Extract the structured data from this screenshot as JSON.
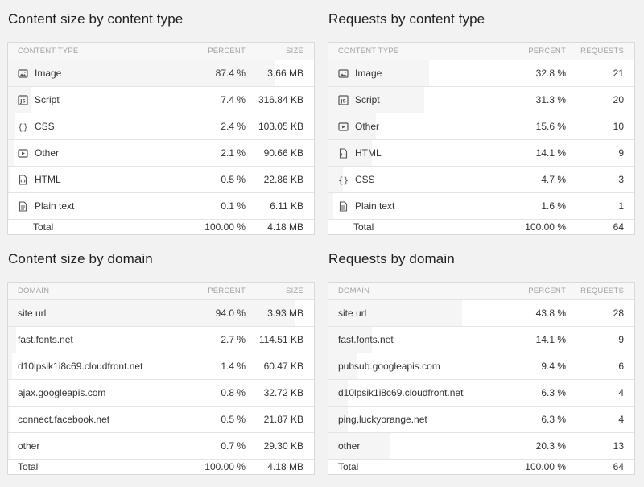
{
  "panels": {
    "size_type": {
      "title": "Content size by content type",
      "headers": {
        "name": "CONTENT TYPE",
        "pct": "PERCENT",
        "val": "SIZE"
      },
      "rows": [
        {
          "name": "Image",
          "pct": "87.4 %",
          "val": "3.66 MB",
          "share": 0.874,
          "icon": "image-icon"
        },
        {
          "name": "Script",
          "pct": "7.4 %",
          "val": "316.84 KB",
          "share": 0.074,
          "icon": "script-icon"
        },
        {
          "name": "CSS",
          "pct": "2.4 %",
          "val": "103.05 KB",
          "share": 0.024,
          "icon": "css-icon"
        },
        {
          "name": "Other",
          "pct": "2.1 %",
          "val": "90.66 KB",
          "share": 0.021,
          "icon": "other-icon"
        },
        {
          "name": "HTML",
          "pct": "0.5 %",
          "val": "22.86 KB",
          "share": 0.005,
          "icon": "html-icon"
        },
        {
          "name": "Plain text",
          "pct": "0.1 %",
          "val": "6.11 KB",
          "share": 0.001,
          "icon": "text-icon"
        }
      ],
      "total": {
        "name": "Total",
        "pct": "100.00 %",
        "val": "4.18 MB"
      }
    },
    "req_type": {
      "title": "Requests by content type",
      "headers": {
        "name": "CONTENT TYPE",
        "pct": "PERCENT",
        "val": "REQUESTS"
      },
      "rows": [
        {
          "name": "Image",
          "pct": "32.8 %",
          "val": "21",
          "share": 0.328,
          "icon": "image-icon"
        },
        {
          "name": "Script",
          "pct": "31.3 %",
          "val": "20",
          "share": 0.313,
          "icon": "script-icon"
        },
        {
          "name": "Other",
          "pct": "15.6 %",
          "val": "10",
          "share": 0.156,
          "icon": "other-icon"
        },
        {
          "name": "HTML",
          "pct": "14.1 %",
          "val": "9",
          "share": 0.141,
          "icon": "html-icon"
        },
        {
          "name": "CSS",
          "pct": "4.7 %",
          "val": "3",
          "share": 0.047,
          "icon": "css-icon"
        },
        {
          "name": "Plain text",
          "pct": "1.6 %",
          "val": "1",
          "share": 0.016,
          "icon": "text-icon"
        }
      ],
      "total": {
        "name": "Total",
        "pct": "100.00 %",
        "val": "64"
      }
    },
    "size_domain": {
      "title": "Content size by domain",
      "headers": {
        "name": "DOMAIN",
        "pct": "PERCENT",
        "val": "SIZE"
      },
      "rows": [
        {
          "name": "site url",
          "pct": "94.0 %",
          "val": "3.93 MB",
          "share": 0.94
        },
        {
          "name": "fast.fonts.net",
          "pct": "2.7 %",
          "val": "114.51 KB",
          "share": 0.027
        },
        {
          "name": "d10lpsik1i8c69.cloudfront.net",
          "pct": "1.4 %",
          "val": "60.47 KB",
          "share": 0.014
        },
        {
          "name": "ajax.googleapis.com",
          "pct": "0.8 %",
          "val": "32.72 KB",
          "share": 0.008
        },
        {
          "name": "connect.facebook.net",
          "pct": "0.5 %",
          "val": "21.87 KB",
          "share": 0.005
        },
        {
          "name": "other",
          "pct": "0.7 %",
          "val": "29.30 KB",
          "share": 0.007
        }
      ],
      "total": {
        "name": "Total",
        "pct": "100.00 %",
        "val": "4.18 MB"
      }
    },
    "req_domain": {
      "title": "Requests by domain",
      "headers": {
        "name": "DOMAIN",
        "pct": "PERCENT",
        "val": "REQUESTS"
      },
      "rows": [
        {
          "name": "site url",
          "pct": "43.8 %",
          "val": "28",
          "share": 0.438
        },
        {
          "name": "fast.fonts.net",
          "pct": "14.1 %",
          "val": "9",
          "share": 0.141
        },
        {
          "name": "pubsub.googleapis.com",
          "pct": "9.4 %",
          "val": "6",
          "share": 0.094
        },
        {
          "name": "d10lpsik1i8c69.cloudfront.net",
          "pct": "6.3 %",
          "val": "4",
          "share": 0.063
        },
        {
          "name": "ping.luckyorange.net",
          "pct": "6.3 %",
          "val": "4",
          "share": 0.063
        },
        {
          "name": "other",
          "pct": "20.3 %",
          "val": "13",
          "share": 0.203
        }
      ],
      "total": {
        "name": "Total",
        "pct": "100.00 %",
        "val": "64"
      }
    }
  }
}
